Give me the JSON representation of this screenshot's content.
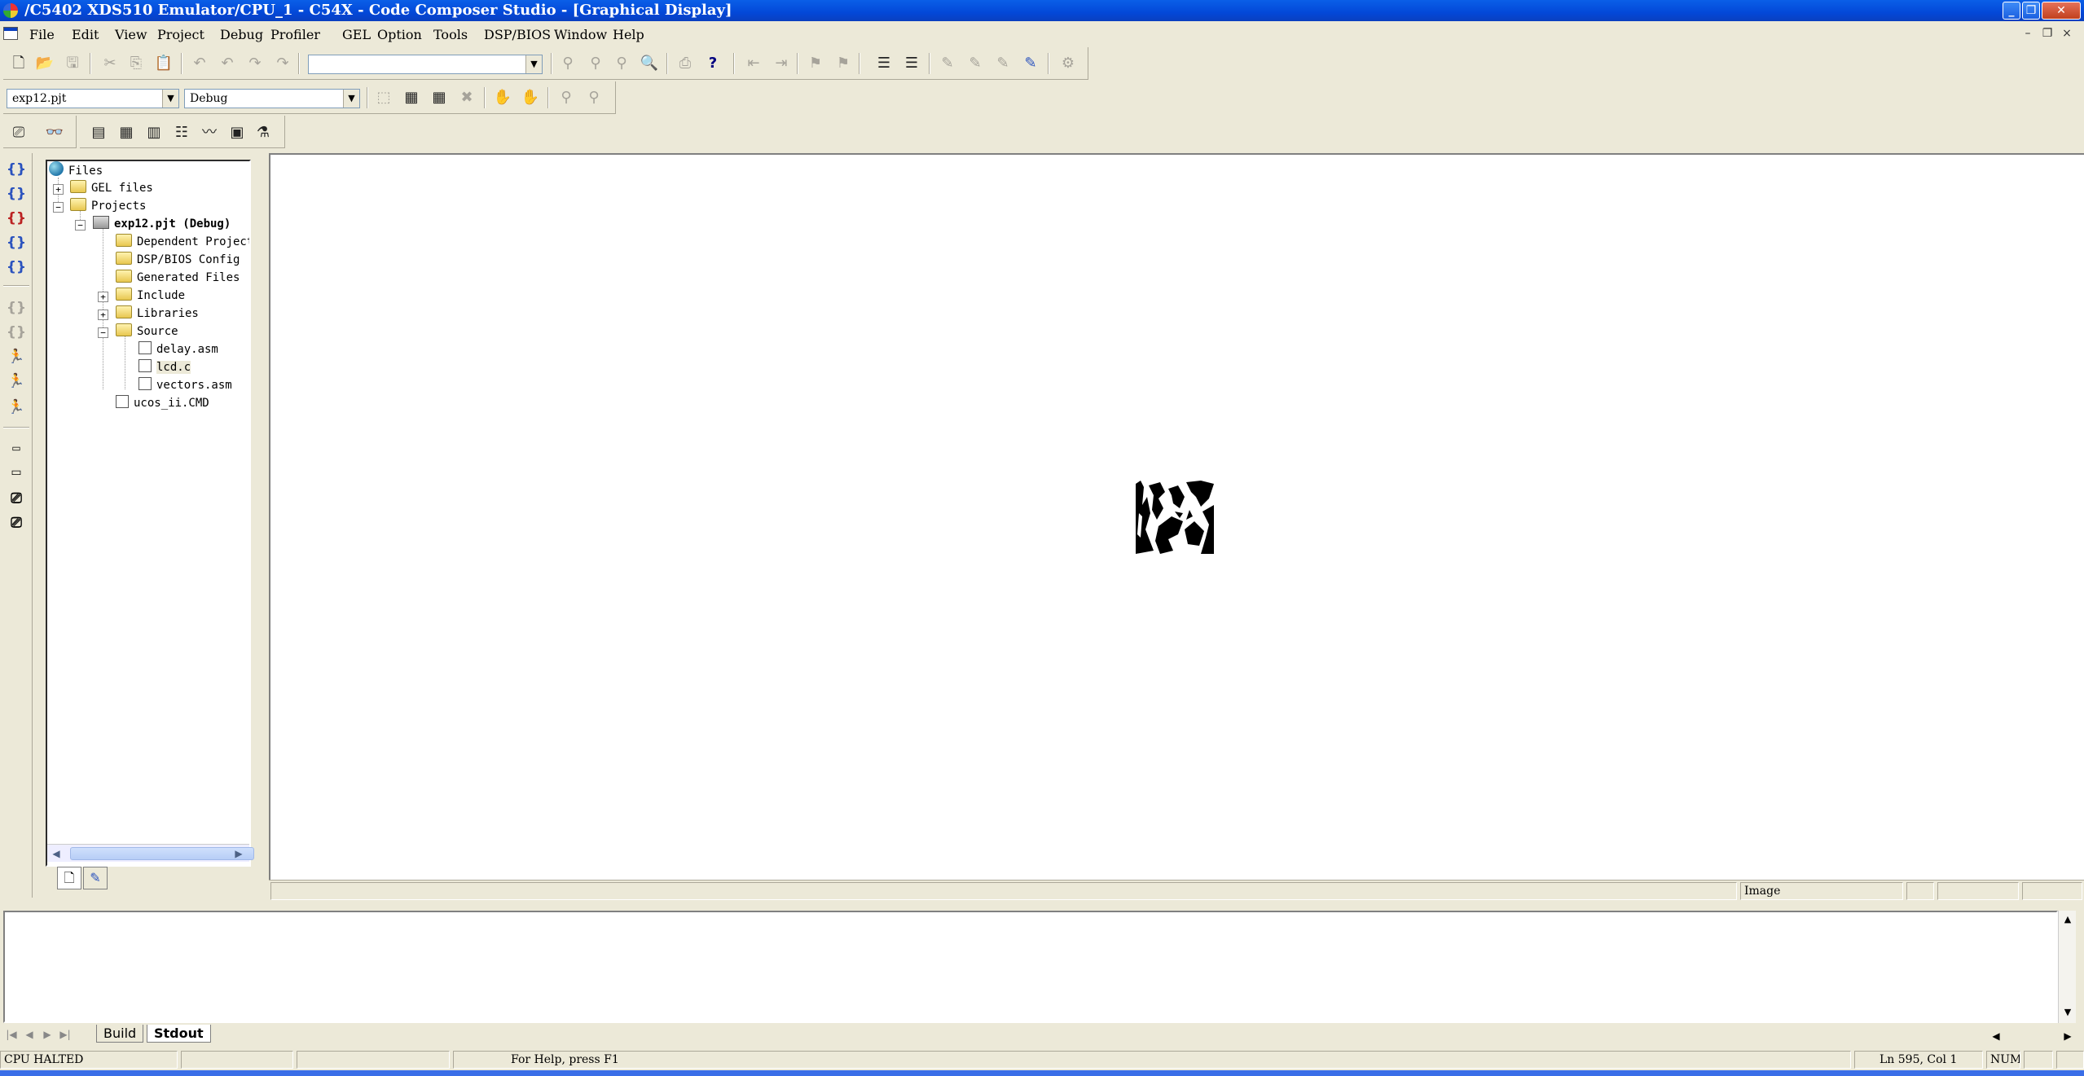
{
  "window": {
    "title": "/C5402 XDS510 Emulator/CPU_1 - C54X - Code Composer Studio - [Graphical Display]",
    "controls": {
      "minimize": "_",
      "restore": "❐",
      "close": "✕"
    }
  },
  "menu": {
    "items": [
      "File",
      "Edit",
      "View",
      "Project",
      "Debug",
      "Profiler",
      "GEL",
      "Option",
      "Tools",
      "DSP/BIOS",
      "Window",
      "Help"
    ],
    "mdi_controls": {
      "minimize": "–",
      "restore": "❐",
      "close": "×"
    }
  },
  "toolbar": {
    "search_value": "",
    "project_combo": "exp12.pjt",
    "config_combo": "Debug"
  },
  "tree": {
    "root": "Files",
    "gel_files": "GEL files",
    "projects": "Projects",
    "project": "exp12.pjt (Debug)",
    "folders": [
      "Dependent Projects",
      "DSP/BIOS Config",
      "Generated Files",
      "Include",
      "Libraries",
      "Source"
    ],
    "source_files": [
      "delay.asm",
      "lcd.c",
      "vectors.asm"
    ],
    "cmd_file": "ucos_ii.CMD",
    "expanders": {
      "collapsed": "+",
      "expanded": "−"
    }
  },
  "graph": {
    "status_label": "Image"
  },
  "output": {
    "tabs": [
      "Build",
      "Stdout"
    ],
    "active_tab": "Stdout",
    "content": ""
  },
  "statusbar": {
    "cpu_state": "CPU HALTED",
    "help_text": "For Help, press F1",
    "position": "Ln 595, Col 1",
    "num_lock": "NUM"
  },
  "icons": {
    "new-file-icon": "🗋",
    "open-icon": "📂",
    "save-icon": "💾",
    "cut-icon": "✂",
    "copy-icon": "⎘",
    "paste-icon": "📋",
    "undo-icon": "↶",
    "redo-icon": "↷",
    "find-icon": "🔍",
    "help-icon": "?"
  }
}
